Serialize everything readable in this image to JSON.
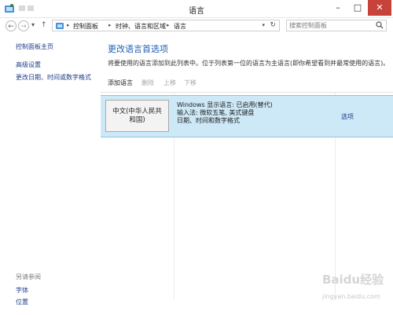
{
  "window": {
    "title": "语言",
    "min_glyph": "–",
    "max_glyph": "□",
    "close_glyph": "✕"
  },
  "nav": {
    "back_glyph": "←",
    "forward_glyph": "→",
    "recent_glyph": "▾",
    "up_glyph": "↑",
    "breadcrumb": [
      "控制面板",
      "时钟、语言和区域",
      "语言"
    ],
    "separator_glyph": "▸",
    "dropdown_glyph": "▾",
    "refresh_glyph": "↻",
    "search_placeholder": "搜索控制面板"
  },
  "sidebar": {
    "home": "控制面板主页",
    "links": [
      "高级设置",
      "更改日期、时间或数字格式"
    ],
    "see_also_heading": "另请参阅",
    "see_also": [
      "字体",
      "位置"
    ]
  },
  "main": {
    "title": "更改语言首选项",
    "description": "将要使用的语言添加到此列表中。位于列表第一位的语言为主语言(即你希望看到并最常使用的语言)。",
    "toolbar": {
      "add": "添加语言",
      "remove": "删除",
      "move_up": "上移",
      "move_down": "下移"
    },
    "languages": [
      {
        "name": "中文(中华人民共和国)",
        "details": [
          "Windows 显示语言: 已启用(替代)",
          "输入法: 微软五笔, 美式键盘",
          "日期、时间和数字格式"
        ],
        "options": "选项"
      }
    ]
  },
  "watermark": {
    "logo": "Baidu经验",
    "url": "jingyan.baidu.com"
  },
  "colors": {
    "accent": "#1f5fb4",
    "link": "#1f3c88",
    "selected_row": "#cde8f6",
    "close_button": "#c7423a"
  },
  "icons": {
    "app": "control-panel-icon",
    "search": "search-icon"
  }
}
